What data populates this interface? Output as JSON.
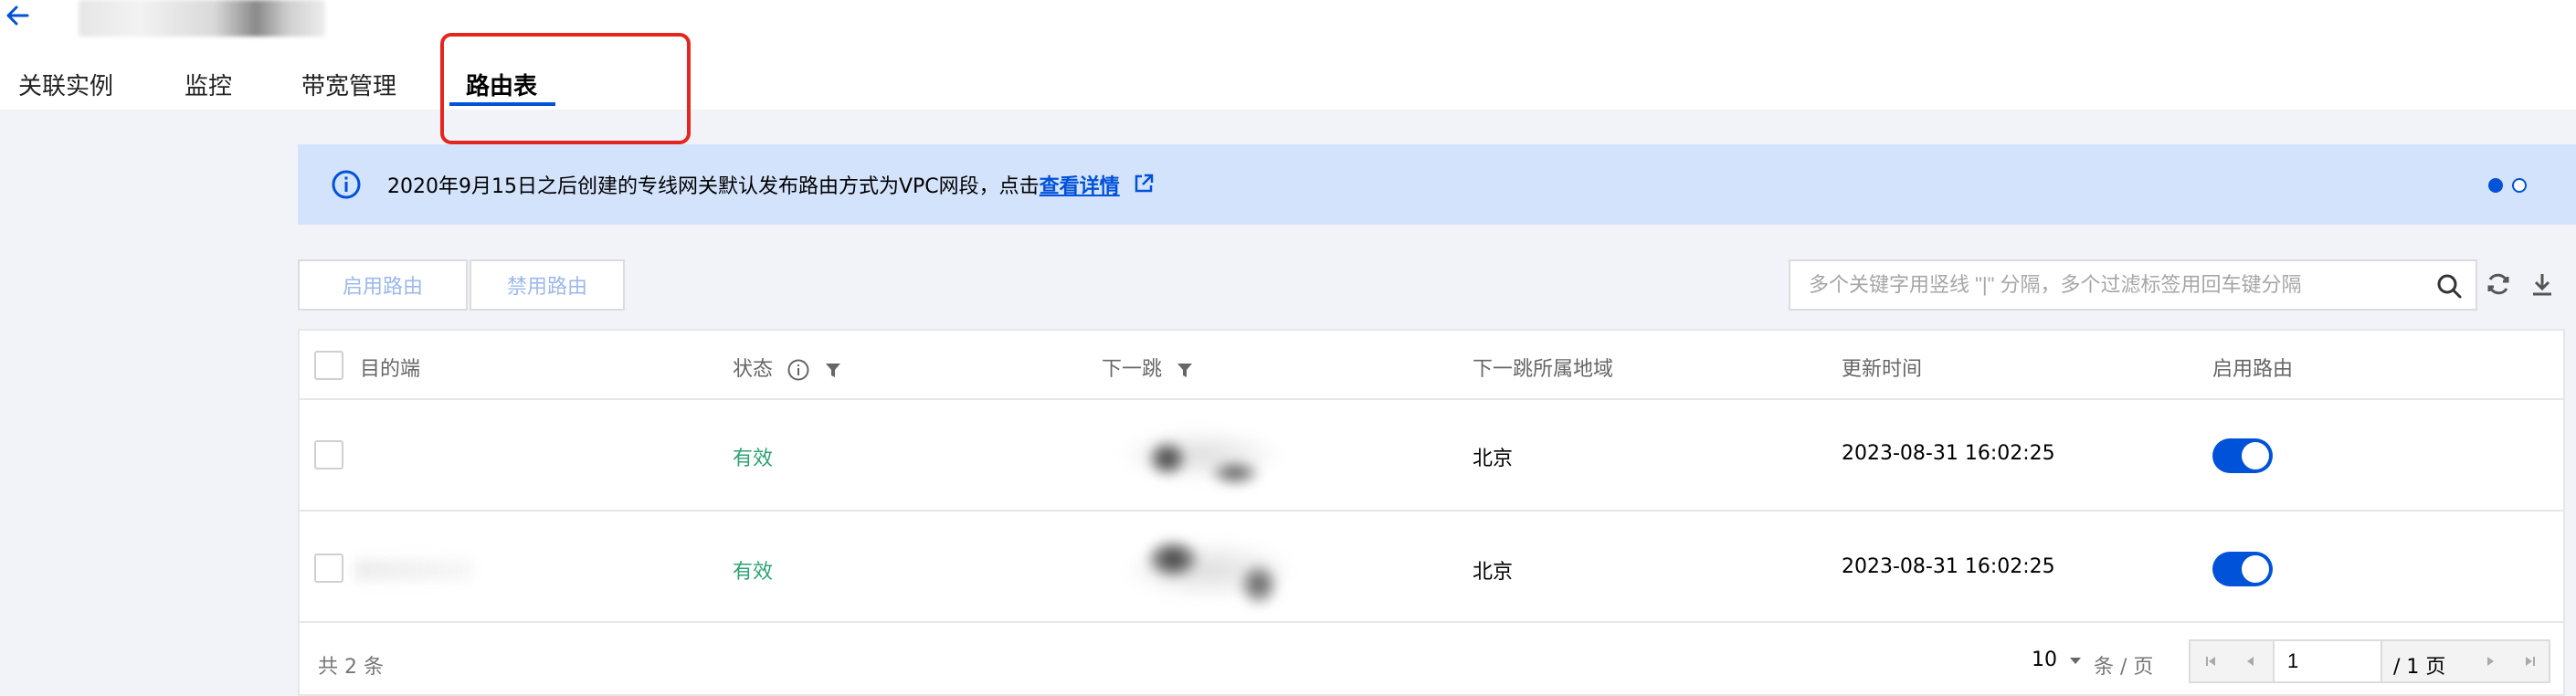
{
  "header": {
    "tabs": [
      {
        "label": "关联实例"
      },
      {
        "label": "监控"
      },
      {
        "label": "带宽管理"
      },
      {
        "label": "路由表",
        "active": true
      }
    ]
  },
  "notice": {
    "text": "2020年9月15日之后创建的专线网关默认发布路由方式为VPC网段，点击",
    "link_label": "查看详情",
    "carousel_active_index": 0
  },
  "toolbar": {
    "enable_label": "启用路由",
    "disable_label": "禁用路由",
    "search_placeholder": "多个关键字用竖线 \"|\" 分隔，多个过滤标签用回车键分隔"
  },
  "table": {
    "columns": [
      "目的端",
      "状态",
      "下一跳",
      "下一跳所属地域",
      "更新时间",
      "启用路由"
    ],
    "rows": [
      {
        "destination": "",
        "status": "有效",
        "next_hop": "",
        "region": "北京",
        "updated": "2023-08-31 16:02:25",
        "enabled": true
      },
      {
        "destination": "",
        "status": "有效",
        "next_hop": "",
        "region": "北京",
        "updated": "2023-08-31 16:02:25",
        "enabled": true
      }
    ]
  },
  "footer": {
    "total_label": "共 2 条",
    "page_size": "10",
    "page_size_unit": "条 / 页",
    "current_page": "1",
    "total_pages": "/ 1 页"
  },
  "colors": {
    "accent": "#0052d9",
    "highlight": "#e5261f",
    "status_ok": "#2ba471",
    "notice_bg": "#d4e3fc"
  }
}
